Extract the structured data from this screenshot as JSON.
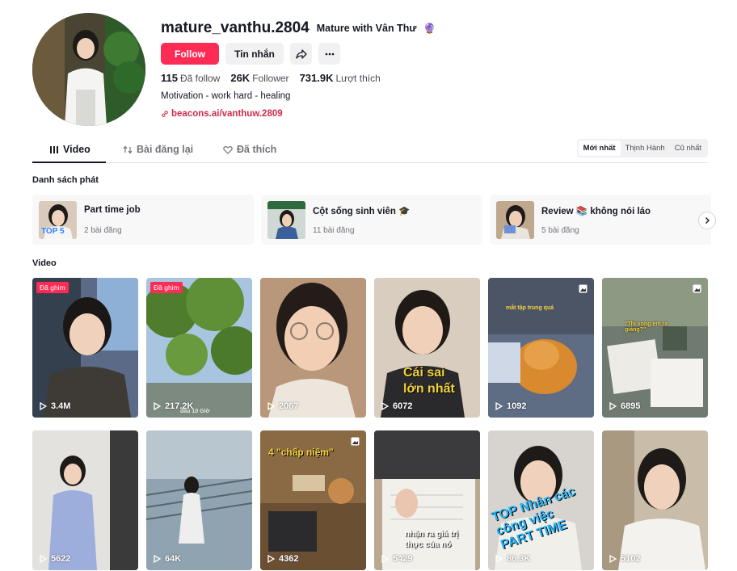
{
  "profile": {
    "username": "mature_vanthu.2804",
    "nickname": "Mature with Vân Thư",
    "nickname_emoji": "🔮",
    "follow_label": "Follow",
    "message_label": "Tin nhắn",
    "following_count": "115",
    "following_label": "Đã follow",
    "followers_count": "26K",
    "followers_label": "Follower",
    "likes_count": "731.9K",
    "likes_label": "Lượt thích",
    "bio": "Motivation - work hard - healing",
    "link": "beacons.ai/vanthuw.2809",
    "accent": "#fe2c55"
  },
  "tabs": {
    "items": [
      {
        "label": "Video",
        "icon": "grid-icon"
      },
      {
        "label": "Bài đăng lại",
        "icon": "repost-icon"
      },
      {
        "label": "Đã thích",
        "icon": "heart-outline-icon"
      }
    ],
    "sort": [
      "Mới nhất",
      "Thịnh Hành",
      "Cũ nhất"
    ]
  },
  "playlists": {
    "title": "Danh sách phát",
    "items": [
      {
        "name": "Part time job",
        "count": "2 bài đăng",
        "thumb_text": "TOP 5"
      },
      {
        "name": "Cột sống sinh viên 🎓",
        "count": "11 bài đăng",
        "thumb_text": ""
      },
      {
        "name": "Review 📚 không nói láo",
        "count": "5 bài đăng",
        "thumb_text": ""
      }
    ]
  },
  "videos": {
    "title": "Video",
    "pinned_label": "Đã ghim",
    "items": [
      {
        "views": "3.4M",
        "pinned": true,
        "caption": ""
      },
      {
        "views": "217.2K",
        "pinned": true,
        "caption": "đầu 10 Giờ"
      },
      {
        "views": "2067",
        "pinned": false,
        "caption": ""
      },
      {
        "views": "6072",
        "pinned": false,
        "caption": "Cái sai lớn nhất"
      },
      {
        "views": "1092",
        "pinned": false,
        "caption": "mắt tập trung quá",
        "multi": true
      },
      {
        "views": "6895",
        "pinned": false,
        "caption": "\"Thi xong em ra giảng?\"",
        "multi": true
      },
      {
        "views": "5622",
        "pinned": false,
        "caption": ""
      },
      {
        "views": "64K",
        "pinned": false,
        "caption": ""
      },
      {
        "views": "4362",
        "pinned": false,
        "caption": "4 \"chấp niệm\"",
        "multi": true
      },
      {
        "views": "5429",
        "pinned": false,
        "caption": "nhận ra giá trị thực của nó"
      },
      {
        "views": "86.3K",
        "pinned": false,
        "caption": "TOP Nhân các công việc PART TIME"
      },
      {
        "views": "5102",
        "pinned": false,
        "caption": ""
      }
    ]
  }
}
